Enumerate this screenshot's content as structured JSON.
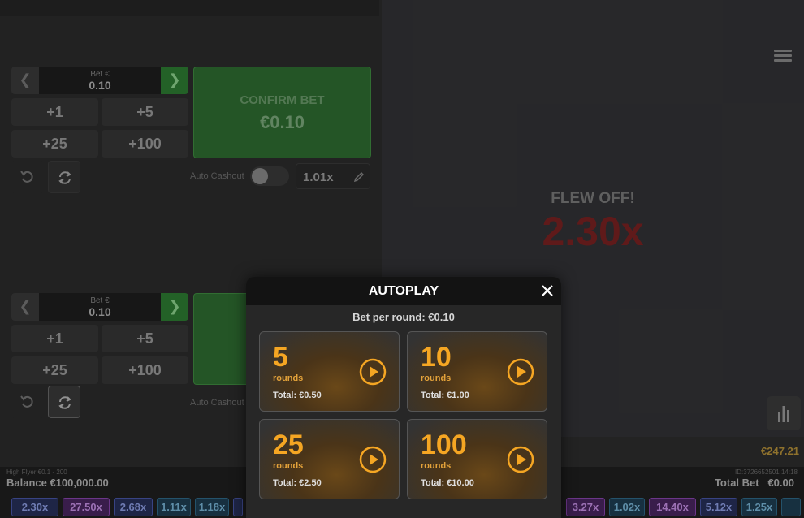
{
  "bet_panels": [
    {
      "bet_label": "Bet €",
      "bet_value": "0.10",
      "quick_adds": [
        "+1",
        "+5",
        "+25",
        "+100"
      ],
      "confirm_label": "CONFIRM BET",
      "confirm_amount": "€0.10",
      "auto_cashout_label": "Auto Cashout",
      "auto_cashout_value": "1.01x"
    },
    {
      "bet_label": "Bet €",
      "bet_value": "0.10",
      "quick_adds": [
        "+1",
        "+5",
        "+25",
        "+100"
      ],
      "auto_cashout_label": "Auto Cashout"
    }
  ],
  "game": {
    "status": "FLEW OFF!",
    "multiplier": "2.30x",
    "won_amount": "€247.21"
  },
  "footer": {
    "game_name": "High Flyer €0.1 - 200",
    "balance": "Balance €100,000.00",
    "round_id": "ID:3726652501 14:18",
    "total_bet_label": "Total Bet",
    "total_bet_value": "€0.00"
  },
  "history": [
    {
      "value": "2.30x",
      "color": "blue"
    },
    {
      "value": "27.50x",
      "color": "purple"
    },
    {
      "value": "2.68x",
      "color": "blue"
    },
    {
      "value": "1.11x",
      "color": "teal"
    },
    {
      "value": "1.18x",
      "color": "teal"
    },
    {
      "value": "3.27x",
      "color": "blue"
    },
    {
      "value": "1.02x",
      "color": "teal"
    },
    {
      "value": "14.40x",
      "color": "purple"
    },
    {
      "value": "5.12x",
      "color": "blue"
    },
    {
      "value": "1.25x",
      "color": "teal"
    }
  ],
  "autoplay": {
    "title": "AUTOPLAY",
    "bet_per_round": "Bet per round: €0.10",
    "options": [
      {
        "rounds": "5",
        "rounds_label": "rounds",
        "total": "Total: €0.50"
      },
      {
        "rounds": "10",
        "rounds_label": "rounds",
        "total": "Total: €1.00"
      },
      {
        "rounds": "25",
        "rounds_label": "rounds",
        "total": "Total: €2.50"
      },
      {
        "rounds": "100",
        "rounds_label": "rounds",
        "total": "Total: €10.00"
      }
    ]
  },
  "colors": {
    "accent_orange": "#f5a623",
    "confirm_green": "#2f6e31",
    "flew_red": "#7a2222"
  }
}
